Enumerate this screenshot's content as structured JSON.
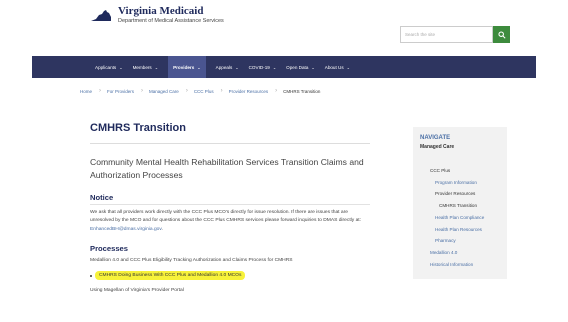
{
  "header": {
    "logo_title": "Virginia Medicaid",
    "logo_subtitle": "Department of Medical Assistance Services",
    "search_placeholder": "Search the site",
    "search_icon": "search-icon",
    "accent_color": "#3d8b3d",
    "brand_color": "#1f2a5c"
  },
  "nav": {
    "items": [
      {
        "label": "Applicants"
      },
      {
        "label": "Members"
      },
      {
        "label": "Providers"
      },
      {
        "label": "Appeals"
      },
      {
        "label": "COVID-19"
      },
      {
        "label": "Open Data"
      },
      {
        "label": "About Us"
      }
    ],
    "active_index": 2,
    "bg_color": "#2e3560"
  },
  "breadcrumb": {
    "items": [
      {
        "label": "Home"
      },
      {
        "label": "For Providers"
      },
      {
        "label": "Managed Care"
      },
      {
        "label": "CCC Plus"
      },
      {
        "label": "Provider Resources"
      },
      {
        "label": "CMHRS Transition"
      }
    ]
  },
  "main": {
    "title": "CMHRS Transition",
    "subtitle": "Community Mental Health Rehabilitation Services Transition Claims and Authorization Processes",
    "notice_heading": "Notice",
    "notice_text": "We ask that all providers work directly with the CCC Plus MCO's directly for issue resolution. If there are issues that are unresolved by the MCO and for questions about the CCC Plus CMHRS services please forward inquiries to DMAS directly at: ",
    "notice_email": "EnhancedBH@dmas.virginia.gov",
    "notice_tail": ".",
    "processes_heading": "Processes",
    "processes_text": "Medallion 4.0 and CCC Plus Eligibility Tracking Authorization and Claims Process for CMHRS",
    "highlighted_link": "CMHRS Doing Business With CCC Plus and Medallion 4.0 MCOs",
    "highlight_color": "#f7f23a",
    "using_text": "Using Magellan of Virginia's Provider Portal"
  },
  "sidebar": {
    "heading": "NAVIGATE",
    "subheading": "Managed Care",
    "items": [
      {
        "label": "CCC Plus"
      },
      {
        "label": "Program Information"
      },
      {
        "label": "Provider Resources"
      },
      {
        "label": "CMHRS Transition"
      },
      {
        "label": "Health Plan Compliance"
      },
      {
        "label": "Health Plan Resources"
      },
      {
        "label": "Pharmacy"
      },
      {
        "label": "Medallion 4.0"
      },
      {
        "label": "Historical Information"
      }
    ]
  }
}
